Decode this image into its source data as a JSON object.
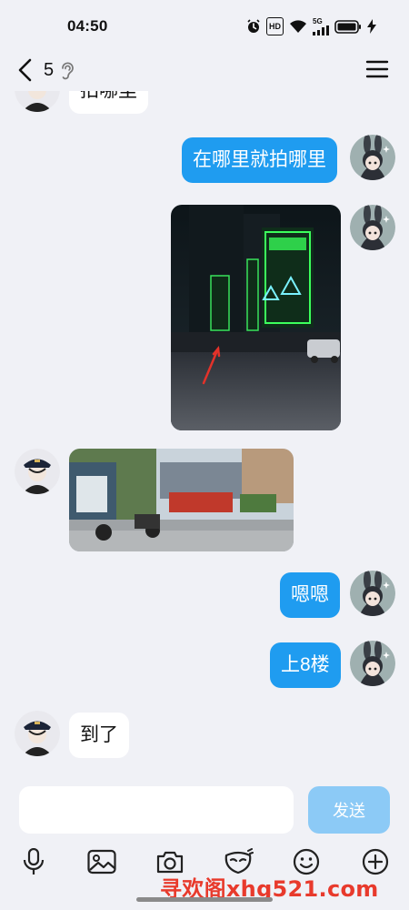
{
  "status": {
    "time": "04:50",
    "hd": "HD",
    "network": "5G",
    "icons": [
      "alarm-icon",
      "hd-icon",
      "wifi-icon",
      "signal-icon",
      "battery-icon",
      "charging-icon"
    ]
  },
  "header": {
    "title": "5",
    "icons": [
      "back-arrow-icon",
      "ear-icon",
      "menu-icon"
    ]
  },
  "messages": [
    {
      "side": "in",
      "type": "text",
      "text": "拍哪里"
    },
    {
      "side": "out",
      "type": "text",
      "text": "在哪里就拍哪里"
    },
    {
      "side": "out",
      "type": "image",
      "description": "night street photo with green shop signs"
    },
    {
      "side": "in",
      "type": "image",
      "description": "daytime plaza photo"
    },
    {
      "side": "out",
      "type": "text",
      "text": "嗯嗯"
    },
    {
      "side": "out",
      "type": "text",
      "text": "上8楼"
    },
    {
      "side": "in",
      "type": "text",
      "text": "到了"
    }
  ],
  "input": {
    "placeholder": "",
    "send_label": "发送"
  },
  "toolbar": {
    "icons": [
      "microphone-icon",
      "image-icon",
      "camera-icon",
      "mask-icon",
      "emoji-icon",
      "plus-icon"
    ]
  },
  "watermark": "寻欢阁xhg521.com",
  "colors": {
    "out_bubble": "#1f9cf0",
    "send_button": "#8ccaf6",
    "background": "#f0f1f6",
    "watermark": "#e83a2c"
  }
}
